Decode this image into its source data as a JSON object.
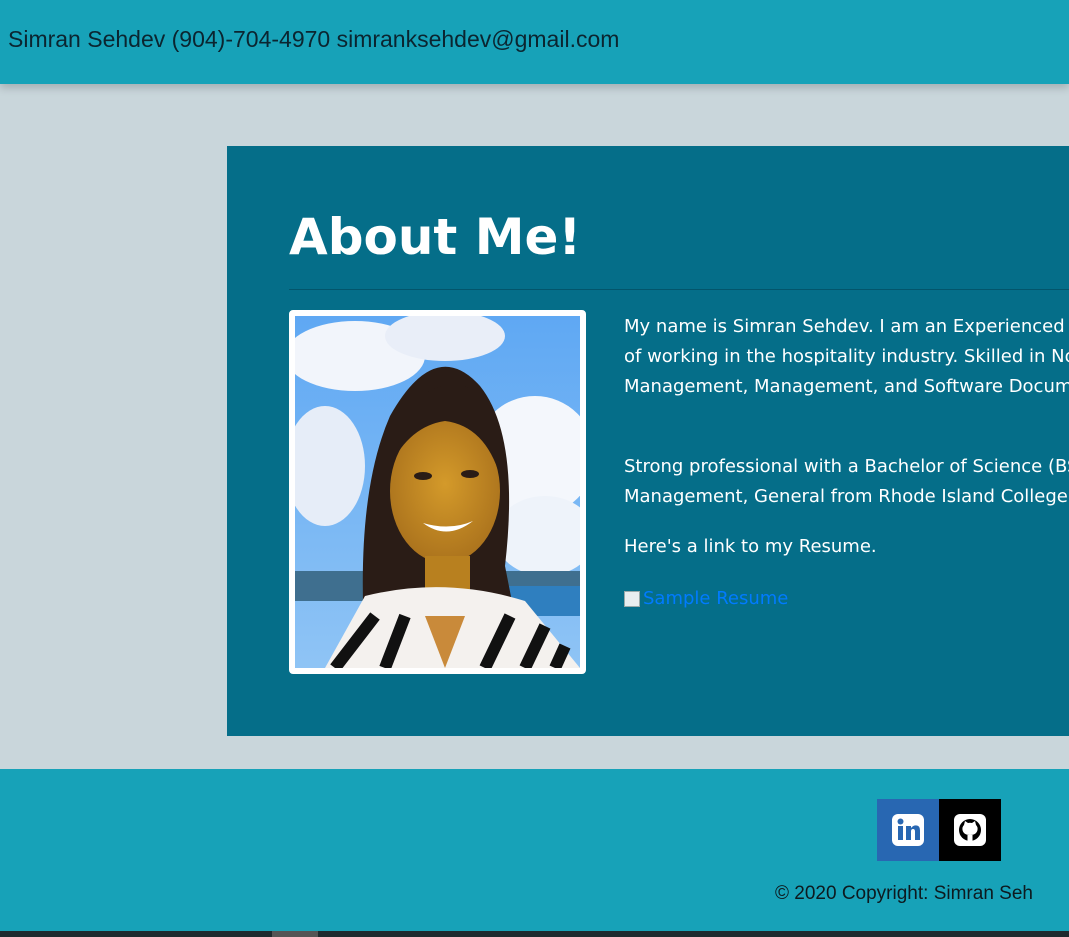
{
  "navbar": {
    "brand": "Simran Sehdev (904)-704-4970 simranksehdev@gmail.com"
  },
  "about": {
    "title": "About Me!",
    "bio_p1_lines": [
      "My name is Simran Sehdev. I am an Experienced As",
      "of working in the hospitality industry. Skilled in No",
      "Management, Management, and Software Docume"
    ],
    "bio_p2_lines": [
      "Strong professional with a Bachelor of Science (BSc",
      "Management, General from Rhode Island College."
    ],
    "bio_p3": "Here's a link to my Resume.",
    "resume_link_text": "Sample Resume"
  },
  "footer": {
    "social": [
      {
        "name": "LinkedIn",
        "icon": "linkedin-icon",
        "color": "#2867b2"
      },
      {
        "name": "GitHub",
        "icon": "github-icon",
        "color": "#000000"
      }
    ],
    "copyright": "© 2020 Copyright: Simran Seh"
  },
  "colors": {
    "navbar_bg": "#17a2b8",
    "page_bg": "#c9d6db",
    "card_bg": "#056e89",
    "link": "#007bff"
  }
}
